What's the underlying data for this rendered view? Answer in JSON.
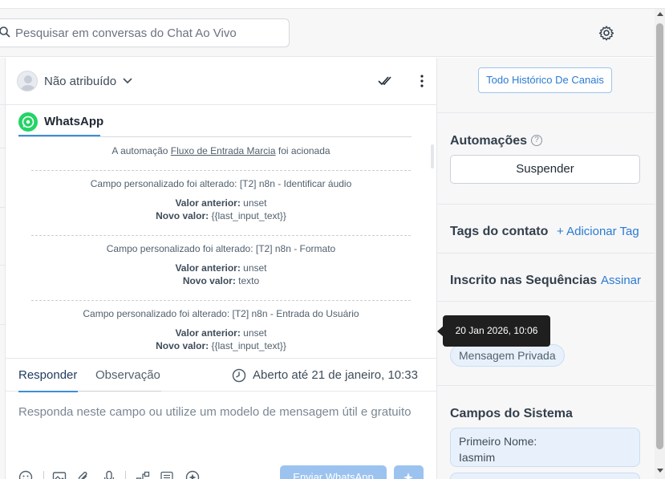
{
  "search": {
    "placeholder": "Pesquisar em conversas do Chat Ao Vivo"
  },
  "header": {
    "icons": [
      "search-icon",
      "gear-icon"
    ]
  },
  "conversation": {
    "assignee": "Não atribuído",
    "channel": "WhatsApp",
    "events": [
      {
        "prefix": "A automação ",
        "link": "Fluxo de Entrada Marcia",
        "suffix": " foi acionada"
      },
      {
        "title": "Campo personalizado foi alterado: [T2] n8n - Identificar áudio",
        "old_label": "Valor anterior:",
        "old_value": " unset",
        "new_label": "Novo valor:",
        "new_value": " {{last_input_text}}"
      },
      {
        "title": "Campo personalizado foi alterado: [T2] n8n - Formato",
        "old_label": "Valor anterior:",
        "old_value": " unset",
        "new_label": "Novo valor:",
        "new_value": " texto"
      },
      {
        "title": "Campo personalizado foi alterado: [T2] n8n - Entrada do Usuário",
        "old_label": "Valor anterior:",
        "old_value": " unset",
        "new_label": "Novo valor:",
        "new_value": " {{last_input_text}}"
      }
    ]
  },
  "composer": {
    "tabs": [
      "Responder",
      "Observação"
    ],
    "open_until": "Aberto até 21 de janeiro, 10:33",
    "placeholder": "Responda neste campo ou utilize um modelo de mensagem útil e gratuito",
    "send_label": "Enviar WhatsApp",
    "toolbar_icons": [
      "emoji-icon",
      "image-icon",
      "attach-icon",
      "microphone-icon",
      "flow-icon",
      "template-icon",
      "ai-icon"
    ]
  },
  "sidebar": {
    "history_button": "Todo Histórico De Canais",
    "automations_title": "Automações",
    "suspend_label": "Suspender",
    "tags_title": "Tags do contato",
    "add_tag": "+ Adicionar Tag",
    "sequences_title": "Inscrito nas Sequências",
    "subscribe": "Assinar",
    "chip": "Mensagem Privada",
    "system_fields_title": "Campos do Sistema",
    "first_name_label": "Primeiro Nome:",
    "first_name_value": "Iasmim"
  },
  "tooltip": "20 Jan 2026, 10:06",
  "colors": {
    "accent": "#3d8ed8",
    "link": "#2b7bd1",
    "whatsapp": "#25d366",
    "tooltip_bg": "#1f1f1f"
  }
}
